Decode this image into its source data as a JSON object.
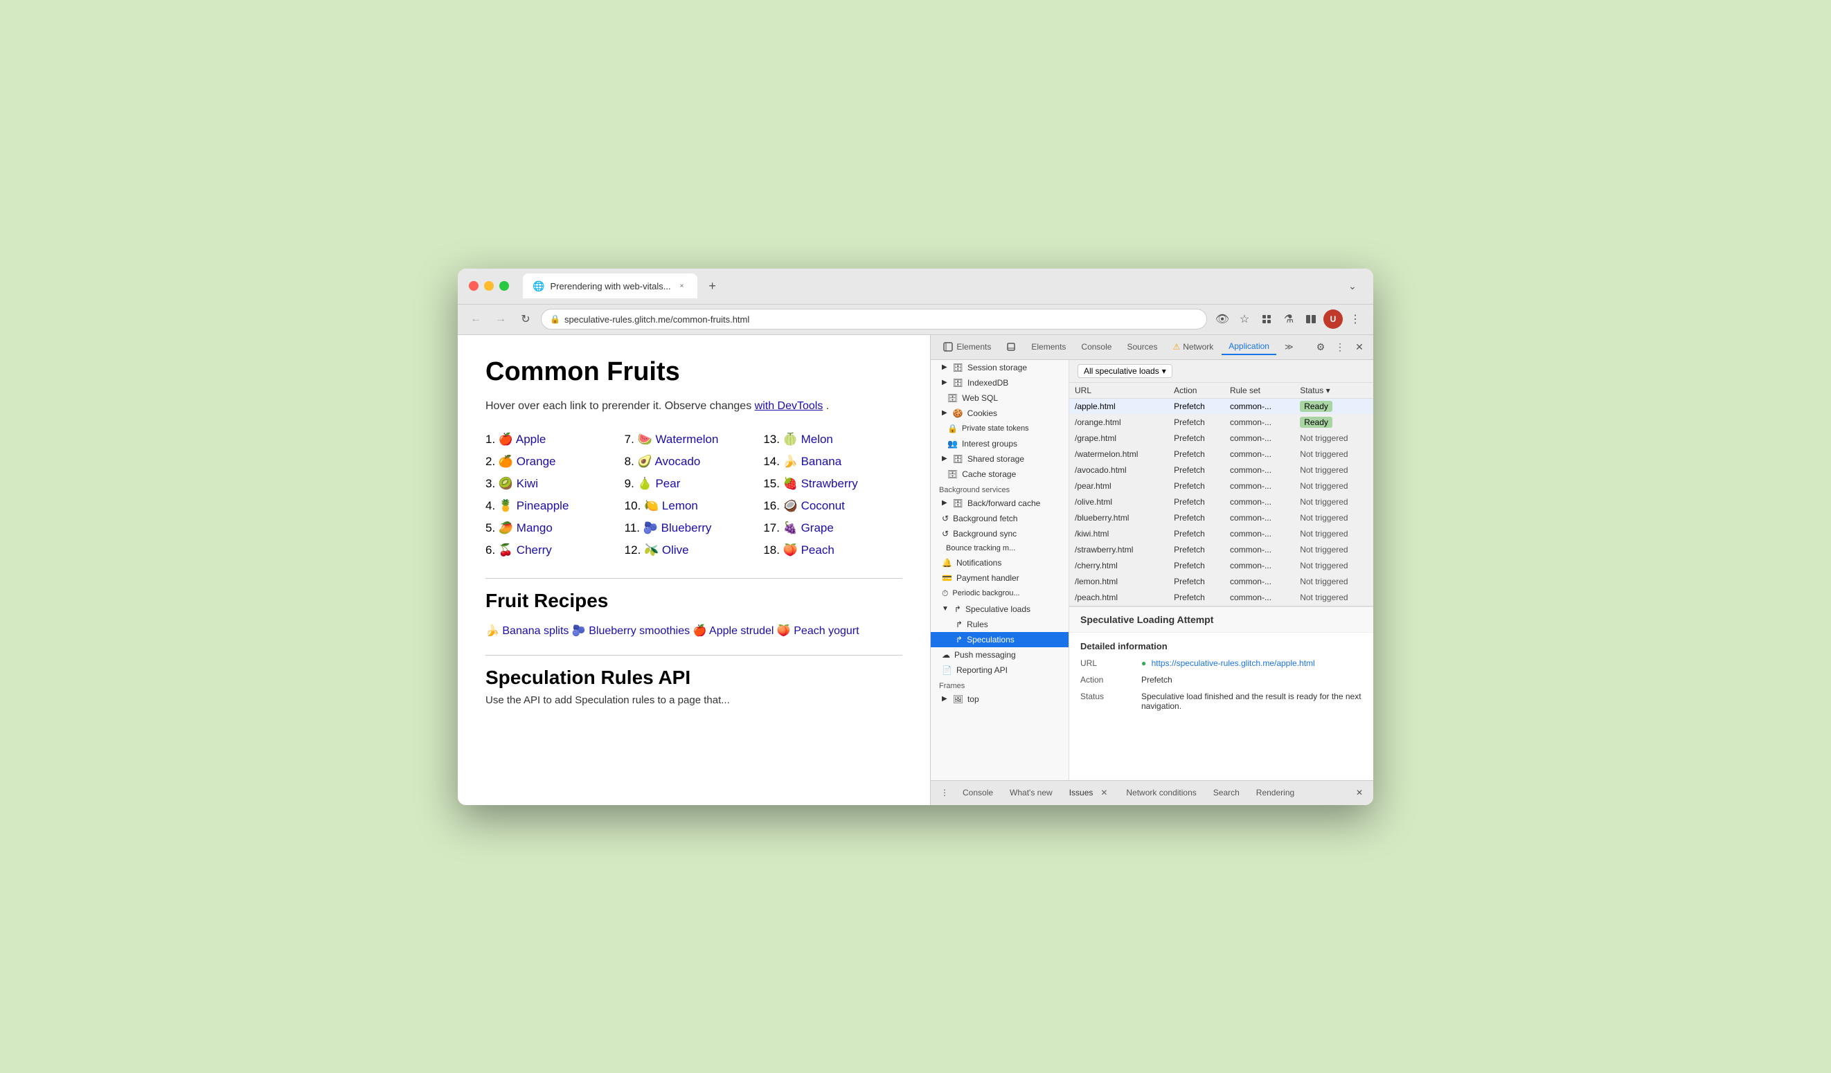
{
  "browser": {
    "tab_title": "Prerendering with web-vitals...",
    "tab_icon": "🌐",
    "new_tab_icon": "+",
    "url": "speculative-rules.glitch.me/common-fruits.html",
    "url_icon": "🔒"
  },
  "nav": {
    "back_label": "←",
    "forward_label": "→",
    "refresh_label": "↻",
    "hidden_eye_label": "👁",
    "star_label": "☆",
    "extensions_label": "🔌",
    "flask_label": "⚗",
    "splitscreen_label": "⊟",
    "menu_label": "⋮"
  },
  "webpage": {
    "title": "Common Fruits",
    "subtitle_text": "Hover over each link to prerender it. Observe changes ",
    "subtitle_link": "with DevTools",
    "subtitle_end": ".",
    "fruits": [
      {
        "num": "1.",
        "emoji": "🍎",
        "name": "Apple",
        "href": "#"
      },
      {
        "num": "2.",
        "emoji": "🍊",
        "name": "Orange",
        "href": "#"
      },
      {
        "num": "3.",
        "emoji": "🥝",
        "name": "Kiwi",
        "href": "#"
      },
      {
        "num": "4.",
        "emoji": "🍍",
        "name": "Pineapple",
        "href": "#"
      },
      {
        "num": "5.",
        "emoji": "🥭",
        "name": "Mango",
        "href": "#"
      },
      {
        "num": "6.",
        "emoji": "🍒",
        "name": "Cherry",
        "href": "#"
      },
      {
        "num": "7.",
        "emoji": "🍉",
        "name": "Watermelon",
        "href": "#"
      },
      {
        "num": "8.",
        "emoji": "🥑",
        "name": "Avocado",
        "href": "#"
      },
      {
        "num": "9.",
        "emoji": "🍐",
        "name": "Pear",
        "href": "#"
      },
      {
        "num": "10.",
        "emoji": "🍋",
        "name": "Lemon",
        "href": "#"
      },
      {
        "num": "11.",
        "emoji": "🫐",
        "name": "Blueberry",
        "href": "#"
      },
      {
        "num": "12.",
        "emoji": "🫒",
        "name": "Olive",
        "href": "#"
      },
      {
        "num": "13.",
        "emoji": "🍈",
        "name": "Melon",
        "href": "#"
      },
      {
        "num": "14.",
        "emoji": "🍌",
        "name": "Banana",
        "href": "#"
      },
      {
        "num": "15.",
        "emoji": "🍓",
        "name": "Strawberry",
        "href": "#"
      },
      {
        "num": "16.",
        "emoji": "🥥",
        "name": "Coconut",
        "href": "#"
      },
      {
        "num": "17.",
        "emoji": "🍇",
        "name": "Grape",
        "href": "#"
      },
      {
        "num": "18.",
        "emoji": "🍑",
        "name": "Peach",
        "href": "#"
      }
    ],
    "recipes_title": "Fruit Recipes",
    "recipes": [
      {
        "emoji": "🍌",
        "name": "Banana splits"
      },
      {
        "emoji": "🫐",
        "name": "Blueberry smoothies"
      },
      {
        "emoji": "🍎",
        "name": "Apple strudel"
      },
      {
        "emoji": "🍑",
        "name": "Peach yogurt"
      }
    ],
    "api_title": "Speculation Rules API",
    "api_desc": "Use the API to add Speculation rules to a page that..."
  },
  "devtools": {
    "tabs": [
      "Elements",
      "Console",
      "Sources",
      "Network",
      "Application"
    ],
    "active_tab": "Application",
    "network_warning": true,
    "sidebar": {
      "storage_items": [
        {
          "label": "Session storage",
          "icon": "▷",
          "indent": 0
        },
        {
          "label": "IndexedDB",
          "icon": "▷",
          "indent": 0
        },
        {
          "label": "Web SQL",
          "icon": "",
          "indent": 0
        },
        {
          "label": "Cookies",
          "icon": "▷",
          "indent": 0
        },
        {
          "label": "Private state tokens",
          "icon": "",
          "indent": 0
        },
        {
          "label": "Interest groups",
          "icon": "",
          "indent": 0
        },
        {
          "label": "Shared storage",
          "icon": "▷",
          "indent": 0
        },
        {
          "label": "Cache storage",
          "icon": "",
          "indent": 0
        }
      ],
      "background_services": "Background services",
      "bg_items": [
        {
          "label": "Back/forward cache",
          "icon": "▷"
        },
        {
          "label": "Background fetch",
          "icon": "↺"
        },
        {
          "label": "Background sync",
          "icon": "↺"
        },
        {
          "label": "Bounce tracking m...",
          "icon": ""
        },
        {
          "label": "Notifications",
          "icon": "🔔"
        },
        {
          "label": "Payment handler",
          "icon": "💳"
        },
        {
          "label": "Periodic background...",
          "icon": "⏱"
        }
      ],
      "speculative_loads": "Speculative loads",
      "spec_items": [
        {
          "label": "Rules",
          "icon": "↱",
          "indent": 1
        },
        {
          "label": "Speculations",
          "icon": "↱",
          "indent": 1,
          "selected": true
        }
      ],
      "push_messaging": "Push messaging",
      "reporting_api": "Reporting API",
      "frames_label": "Frames",
      "frames_items": [
        {
          "label": "top",
          "icon": "▷",
          "indent": 0
        }
      ]
    },
    "spec_loads_header": "All speculative loads",
    "table_columns": [
      "URL",
      "Action",
      "Rule set",
      "Status"
    ],
    "table_rows": [
      {
        "url": "/apple.html",
        "action": "Prefetch",
        "rule_set": "common-...",
        "status": "Ready",
        "selected": true
      },
      {
        "url": "/orange.html",
        "action": "Prefetch",
        "rule_set": "common-...",
        "status": "Ready",
        "selected": false
      },
      {
        "url": "/grape.html",
        "action": "Prefetch",
        "rule_set": "common-...",
        "status": "Not triggered",
        "selected": false
      },
      {
        "url": "/watermelon.html",
        "action": "Prefetch",
        "rule_set": "common-...",
        "status": "Not triggered",
        "selected": false
      },
      {
        "url": "/avocado.html",
        "action": "Prefetch",
        "rule_set": "common-...",
        "status": "Not triggered",
        "selected": false
      },
      {
        "url": "/pear.html",
        "action": "Prefetch",
        "rule_set": "common-...",
        "status": "Not triggered",
        "selected": false
      },
      {
        "url": "/olive.html",
        "action": "Prefetch",
        "rule_set": "common-...",
        "status": "Not triggered",
        "selected": false
      },
      {
        "url": "/blueberry.html",
        "action": "Prefetch",
        "rule_set": "common-...",
        "status": "Not triggered",
        "selected": false
      },
      {
        "url": "/kiwi.html",
        "action": "Prefetch",
        "rule_set": "common-...",
        "status": "Not triggered",
        "selected": false
      },
      {
        "url": "/strawberry.html",
        "action": "Prefetch",
        "rule_set": "common-...",
        "status": "Not triggered",
        "selected": false
      },
      {
        "url": "/cherry.html",
        "action": "Prefetch",
        "rule_set": "common-...",
        "status": "Not triggered",
        "selected": false
      },
      {
        "url": "/lemon.html",
        "action": "Prefetch",
        "rule_set": "common-...",
        "status": "Not triggered",
        "selected": false
      },
      {
        "url": "/peach.html",
        "action": "Prefetch",
        "rule_set": "common-...",
        "status": "Not triggered",
        "selected": false
      }
    ],
    "detail_panel_title": "Speculative Loading Attempt",
    "detail_section_title": "Detailed information",
    "detail_url_label": "URL",
    "detail_url_value": "https://speculative-rules.glitch.me/apple.html",
    "detail_action_label": "Action",
    "detail_action_value": "Prefetch",
    "detail_status_label": "Status",
    "detail_status_value": "Speculative load finished and the result is ready for the next navigation."
  },
  "bottom_tabs": [
    "Console",
    "What's new",
    "Issues",
    "Network conditions",
    "Search",
    "Rendering"
  ],
  "bottom_active": "Issues",
  "colors": {
    "ready_bg": "#a8d5a2",
    "selected_row_bg": "#e8f0fe",
    "active_tab_color": "#1a73e8",
    "link_color": "#1a0dab"
  }
}
